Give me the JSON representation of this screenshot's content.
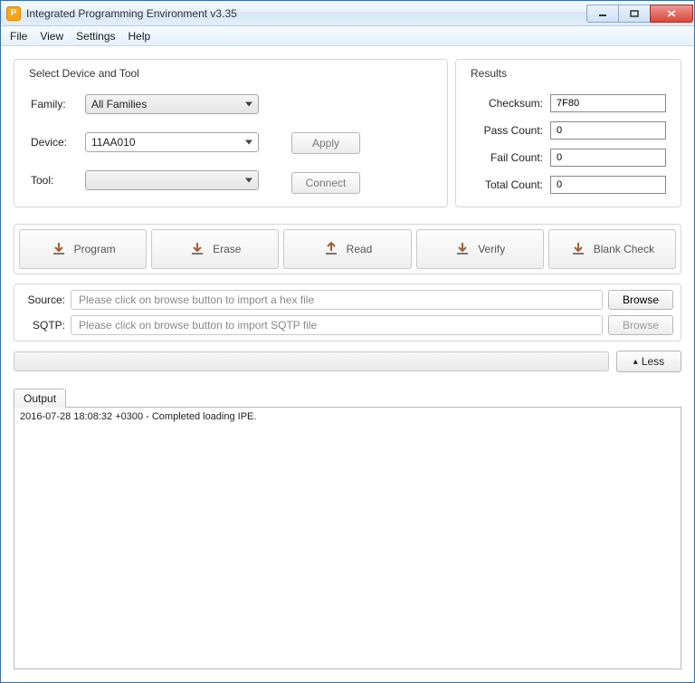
{
  "title": "Integrated Programming Environment v3.35",
  "menubar": {
    "file": "File",
    "view": "View",
    "settings": "Settings",
    "help": "Help"
  },
  "select_group": {
    "title": "Select Device and Tool",
    "family_label": "Family:",
    "family_value": "All Families",
    "device_label": "Device:",
    "device_value": "11AA010",
    "tool_label": "Tool:",
    "tool_value": "",
    "apply": "Apply",
    "connect": "Connect"
  },
  "results": {
    "title": "Results",
    "checksum_label": "Checksum:",
    "checksum_value": "7F80",
    "pass_label": "Pass Count:",
    "pass_value": "0",
    "fail_label": "Fail Count:",
    "fail_value": "0",
    "total_label": "Total Count:",
    "total_value": "0"
  },
  "actions": {
    "program": "Program",
    "erase": "Erase",
    "read": "Read",
    "verify": "Verify",
    "blank": "Blank Check"
  },
  "files": {
    "source_label": "Source:",
    "source_placeholder": "Please click on browse button to import a hex file",
    "sqtp_label": "SQTP:",
    "sqtp_placeholder": "Please click on browse button to import SQTP file",
    "browse": "Browse"
  },
  "less_label": "Less",
  "output": {
    "tab": "Output",
    "text": "2016-07-28 18:08:32 +0300 - Completed loading IPE."
  }
}
